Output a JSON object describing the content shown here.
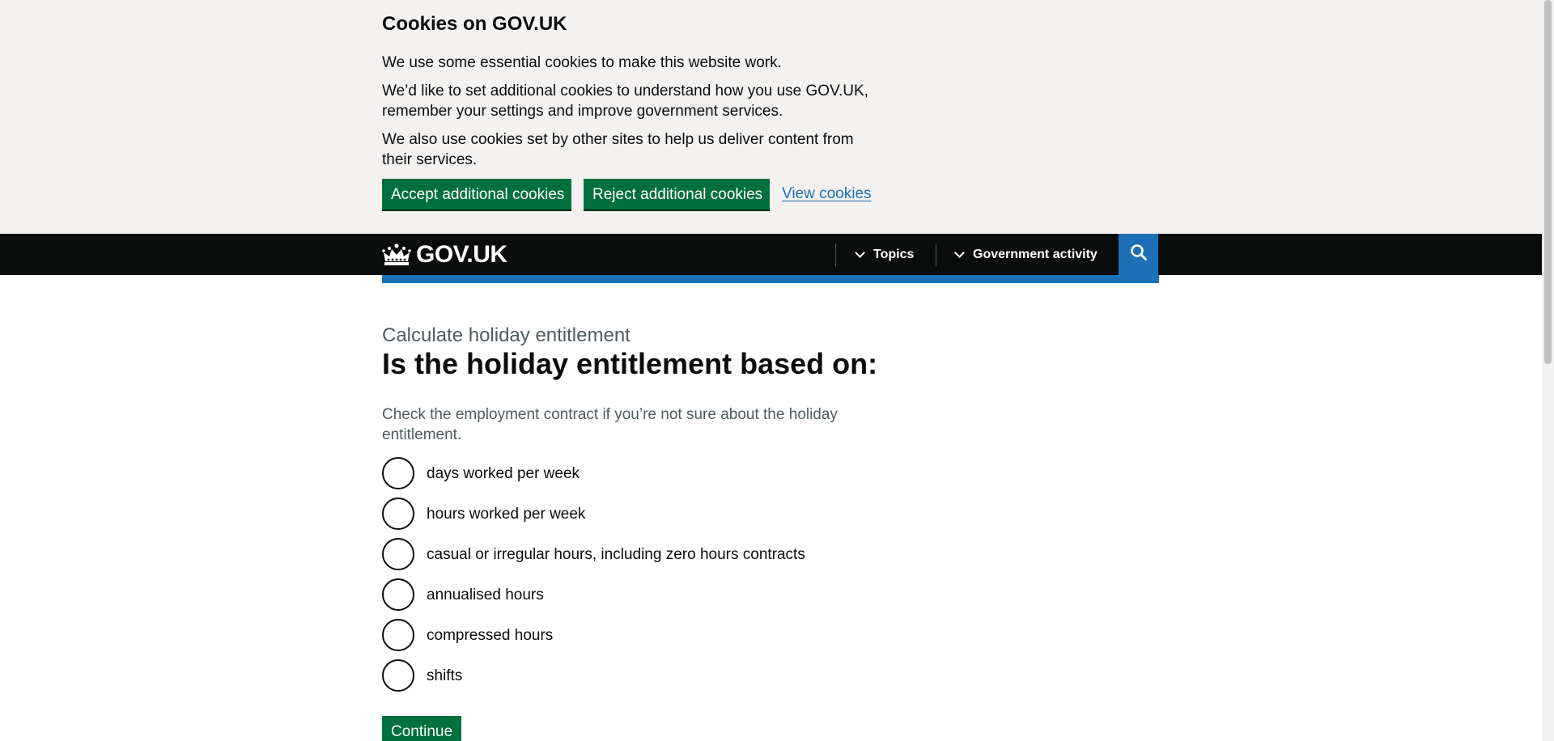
{
  "cookie_banner": {
    "title": "Cookies on GOV.UK",
    "paragraphs": [
      "We use some essential cookies to make this website work.",
      "We’d like to set additional cookies to understand how you use GOV.UK, remember your settings and improve government services.",
      "We also use cookies set by other sites to help us deliver content from their services."
    ],
    "accept_label": "Accept additional cookies",
    "reject_label": "Reject additional cookies",
    "view_label": "View cookies"
  },
  "header": {
    "logo_text": "GOV.UK",
    "nav": [
      {
        "label": "Topics",
        "icon": "chevron-down-icon"
      },
      {
        "label": "Government activity",
        "icon": "chevron-down-icon"
      }
    ],
    "search_icon": "search-icon"
  },
  "main": {
    "caption": "Calculate holiday entitlement",
    "heading": "Is the holiday entitlement based on:",
    "hint": "Check the employment contract if you’re not sure about the holiday entitlement.",
    "options": [
      "days worked per week",
      "hours worked per week",
      "casual or irregular hours, including zero hours contracts",
      "annualised hours",
      "compressed hours",
      "shifts"
    ],
    "continue_label": "Continue"
  },
  "colors": {
    "button_green": "#00703c",
    "link_blue": "#1d70b8",
    "header_black": "#0b0c0c",
    "banner_grey": "#f3f2f1"
  }
}
